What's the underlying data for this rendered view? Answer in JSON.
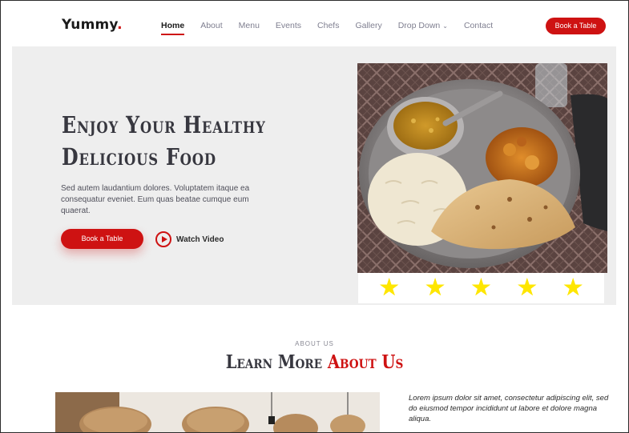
{
  "header": {
    "logo_text": "Yummy",
    "logo_dot": ".",
    "nav": [
      "Home",
      "About",
      "Menu",
      "Events",
      "Chefs",
      "Gallery",
      "Drop Down",
      "Contact"
    ],
    "book_button": "Book a Table"
  },
  "hero": {
    "title_line1": "Enjoy Your Healthy",
    "title_line2": "Delicious Food",
    "description": "Sed autem laudantium dolores. Voluptatem itaque ea consequatur eveniet. Eum quas beatae cumque eum quaerat.",
    "book_button": "Book a Table",
    "watch_label": "Watch Video",
    "rating_stars": 5
  },
  "about": {
    "eyebrow": "ABOUT US",
    "title_part1": "Learn More",
    "title_part2": "About Us",
    "text": "Lorem ipsum dolor sit amet, consectetur adipiscing elit, sed do eiusmod tempor incididunt ut labore et dolore magna aliqua."
  },
  "colors": {
    "accent": "#ce1212",
    "hero_bg": "#eeeeee",
    "star": "#fee600"
  },
  "icons": [
    "play-icon",
    "chevron-down-icon",
    "star-icon"
  ]
}
